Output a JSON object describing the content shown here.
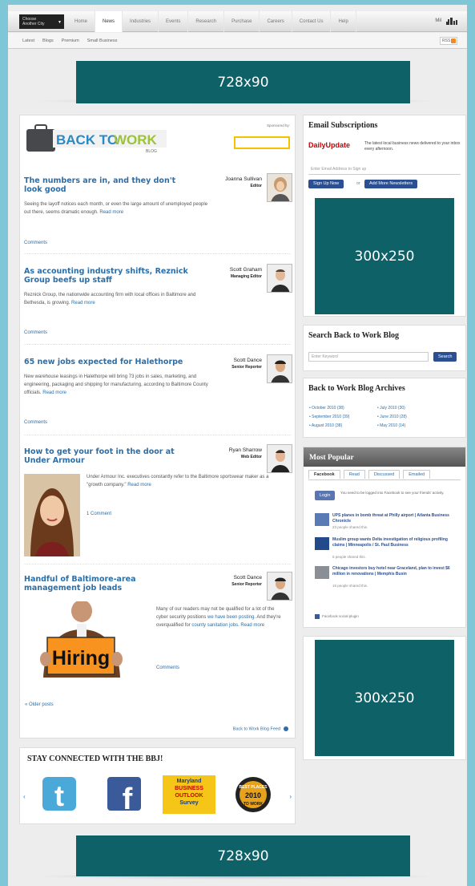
{
  "topnav": {
    "city_line1": "Choose",
    "city_line2": "Another City",
    "links": [
      "Home",
      "News",
      "Industries",
      "Events",
      "Research",
      "Purchase",
      "Careers",
      "Contact Us",
      "Help"
    ],
    "right_label": "Mil"
  },
  "subnav": {
    "links": [
      "Latest",
      "Blogs",
      "Premium",
      "Small Business"
    ],
    "rss_label": "RSS"
  },
  "ads": {
    "top_leaderboard": "728x90",
    "sidebar_1": "300x250",
    "sidebar_2": "300x250",
    "bottom_leaderboard": "728x90"
  },
  "blog": {
    "logo_back_to": "BACK TO",
    "logo_work": "WORK",
    "logo_blog": "BLOG",
    "sponsored_by": "Sponsored by:",
    "posts": [
      {
        "title": "The numbers are in, and they don't look good",
        "author": "Joanna Sullivan",
        "role": "Editor",
        "excerpt": "Seeing the layoff notices each month, or even the large amount of unemployed people out there, seems dramatic enough.",
        "more": "Read more",
        "comments": "Comments"
      },
      {
        "title": "As accounting industry shifts, Reznick Group beefs up staff",
        "author": "Scott Graham",
        "role": "Managing Editor",
        "excerpt": "Reznick Group, the nationwide accounting firm with local offices in Baltimore and Bethesda, is growing.",
        "more": "Read more",
        "comments": "Comments"
      },
      {
        "title": "65 new jobs expected for Halethorpe",
        "author": "Scott Dance",
        "role": "Senior Reporter",
        "excerpt": "New warehouse leasings in Halethorpe will bring 73 jobs in sales, marketing, and engineering, packaging and shipping for manufacturing, according to Baltimore County officials.",
        "more": "Read more",
        "comments": "Comments"
      },
      {
        "title": "How to get your foot in the door at Under Armour",
        "author": "Ryan Sharrow",
        "role": "Web Editor",
        "excerpt": "Under Armour Inc. executives constantly refer to the Baltimore sportswear maker as a \"growth company.\"",
        "more": "Read more",
        "comments": "1 Comment"
      },
      {
        "title": "Handful of Baltimore-area management job leads",
        "author": "Scott Dance",
        "role": "Senior Reporter",
        "excerpt_a": "Many of our readers may not be qualified for a lot of the cyber security positions",
        "link_a": "we have been posting",
        "excerpt_b": ". And they're overqualified for",
        "link_b": "county sanitation jobs",
        "more": "Read more",
        "comments": "Comments",
        "sign_text": "Hiring"
      }
    ],
    "older_posts": "« Older posts",
    "feed_link": "Back to Work Blog Feed"
  },
  "stay": {
    "title": "STAY CONNECTED WITH THE BBJ!",
    "tile_md_line1": "Maryland",
    "tile_md_line2": "BUSINESS",
    "tile_md_line3": "OUTLOOK",
    "tile_md_line4": "Survey",
    "tile_best_line1": "BEST PLACES",
    "tile_best_line2": "2010",
    "tile_best_line3": "TO WORK"
  },
  "email": {
    "title": "Email Subscriptions",
    "brand": "DailyUpdate",
    "desc": "The latest local business news delivered to your inbox every afternoon.",
    "placeholder": "Enter Email Address to Sign up",
    "signup": "Sign Up Now",
    "or": "or",
    "more": "Add More Newsletters"
  },
  "search": {
    "title": "Search Back to Work Blog",
    "placeholder": "Enter Keyword",
    "button": "Search"
  },
  "archives": {
    "title": "Back to Work Blog Archives",
    "col1": [
      "October 2010 (38)",
      "September 2010 (39)",
      "August 2010 (38)"
    ],
    "col2": [
      "July 2010 (30)",
      "June 2010 (28)",
      "May 2010 (14)"
    ]
  },
  "popular": {
    "title": "Most Popular",
    "tabs": [
      "Facebook",
      "Read",
      "Discussed",
      "Emailed"
    ],
    "login": "Login",
    "login_note": "You need to be logged into Facebook to see your friends' activity.",
    "items": [
      {
        "title": "UPS planes in bomb threat at Philly airport | Atlanta Business Chronicle",
        "shared": "23 people shared this."
      },
      {
        "title": "Muslim group wants Delta investigation of religious profiling claims | Minneapolis / St. Paul Business",
        "shared": "6 people shared this."
      },
      {
        "title": "Chicago investors buy hotel near Graceland, plan to invest $6 million in renovations | Memphis Busin",
        "shared": "15 people shared this."
      }
    ],
    "plugin": "Facebook social plugin"
  }
}
